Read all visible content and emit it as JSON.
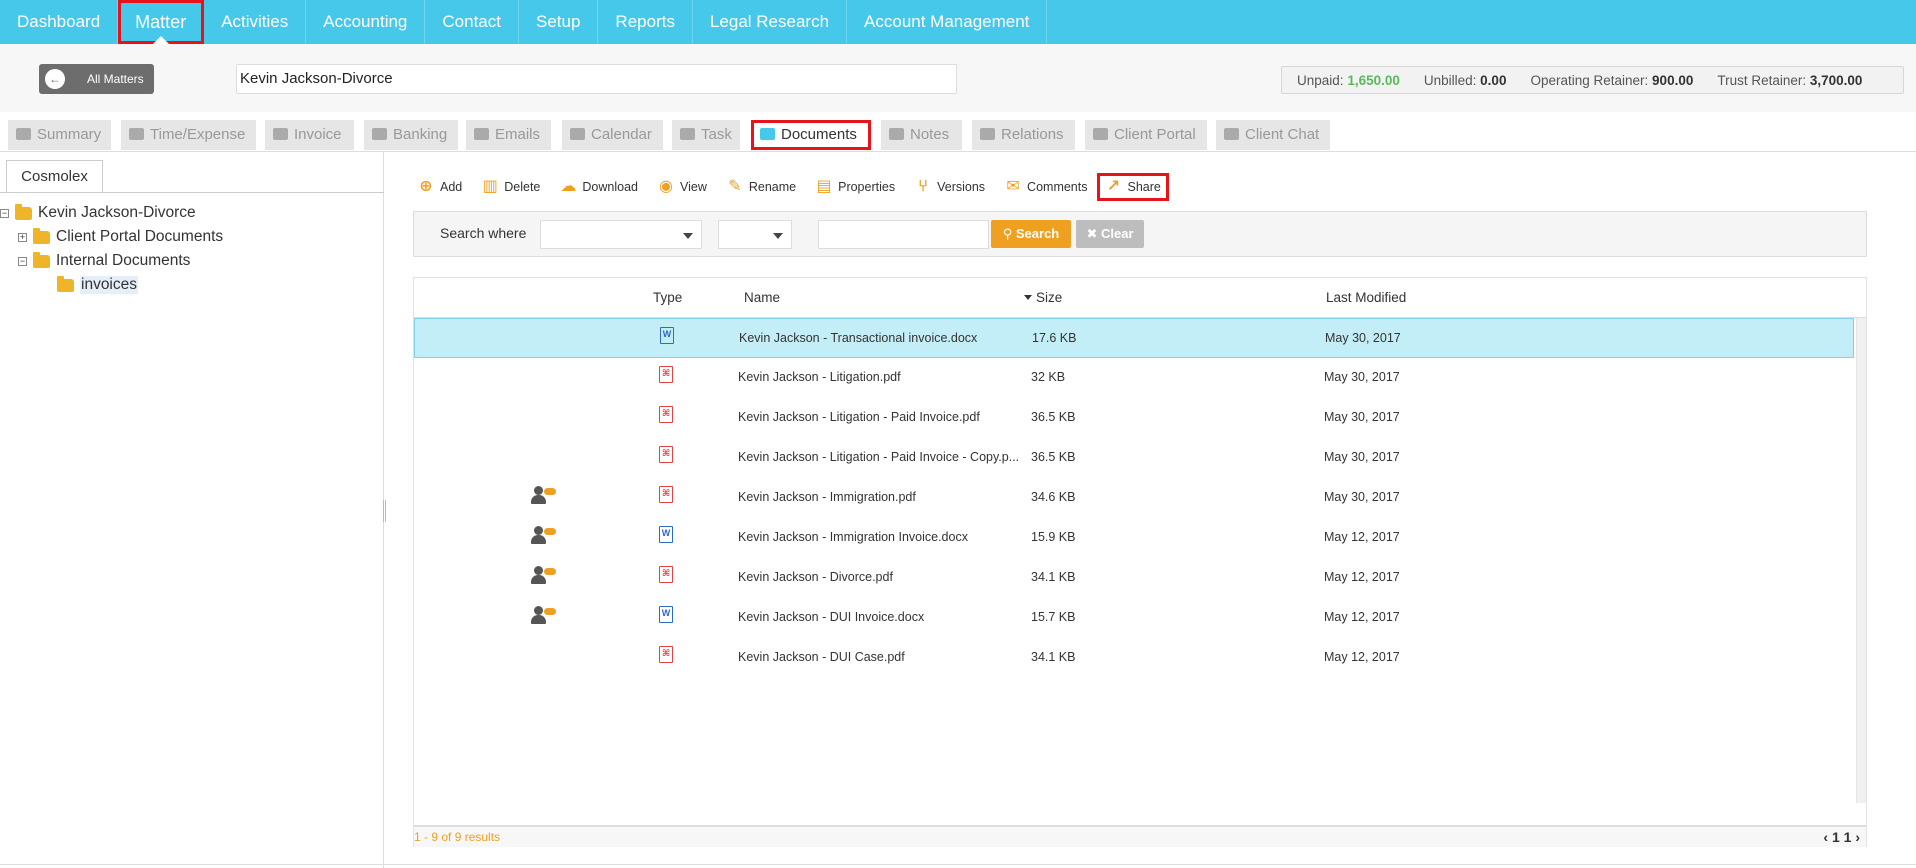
{
  "nav": {
    "items": [
      "Dashboard",
      "Matter",
      "Activities",
      "Accounting",
      "Contact",
      "Setup",
      "Reports",
      "Legal Research",
      "Account Management"
    ],
    "active": "Matter"
  },
  "header": {
    "all_matters": "All Matters",
    "matter_name": "Kevin Jackson-Divorce",
    "balances": {
      "unpaid_label": "Unpaid:",
      "unpaid": "1,650.00",
      "unbilled_label": "Unbilled:",
      "unbilled": "0.00",
      "operating_label": "Operating Retainer:",
      "operating": "900.00",
      "trust_label": "Trust Retainer:",
      "trust": "3,700.00"
    }
  },
  "tabs": [
    "Summary",
    "Time/Expense",
    "Invoice",
    "Banking",
    "Emails",
    "Calendar",
    "Task",
    "Documents",
    "Notes",
    "Relations",
    "Client Portal",
    "Client Chat"
  ],
  "active_tab": "Documents",
  "tree": {
    "tab_label": "Cosmolex",
    "root": "Kevin Jackson-Divorce",
    "client_portal": "Client Portal Documents",
    "internal": "Internal Documents",
    "invoices": "invoices"
  },
  "toolbar": {
    "add": "Add",
    "delete": "Delete",
    "download": "Download",
    "view": "View",
    "rename": "Rename",
    "properties": "Properties",
    "versions": "Versions",
    "comments": "Comments",
    "share": "Share"
  },
  "search": {
    "label": "Search where",
    "search_btn": "Search",
    "clear_btn": "Clear"
  },
  "grid": {
    "columns": {
      "type": "Type",
      "name": "Name",
      "size": "Size",
      "modified": "Last Modified"
    },
    "rows": [
      {
        "type": "word",
        "portal": false,
        "name": "Kevin Jackson - Transactional invoice.docx",
        "size": "17.6 KB",
        "modified": "May 30, 2017"
      },
      {
        "type": "pdf",
        "portal": false,
        "name": "Kevin Jackson - Litigation.pdf",
        "size": "32 KB",
        "modified": "May 30, 2017"
      },
      {
        "type": "pdf",
        "portal": false,
        "name": "Kevin Jackson - Litigation - Paid Invoice.pdf",
        "size": "36.5 KB",
        "modified": "May 30, 2017"
      },
      {
        "type": "pdf",
        "portal": false,
        "name": "Kevin Jackson - Litigation - Paid Invoice - Copy.p...",
        "size": "36.5 KB",
        "modified": "May 30, 2017"
      },
      {
        "type": "pdf",
        "portal": true,
        "name": "Kevin Jackson - Immigration.pdf",
        "size": "34.6 KB",
        "modified": "May 30, 2017"
      },
      {
        "type": "word",
        "portal": true,
        "name": "Kevin Jackson - Immigration Invoice.docx",
        "size": "15.9 KB",
        "modified": "May 12, 2017"
      },
      {
        "type": "pdf",
        "portal": true,
        "name": "Kevin Jackson - Divorce.pdf",
        "size": "34.1 KB",
        "modified": "May 12, 2017"
      },
      {
        "type": "word",
        "portal": true,
        "name": "Kevin Jackson - DUI Invoice.docx",
        "size": "15.7 KB",
        "modified": "May 12, 2017"
      },
      {
        "type": "pdf",
        "portal": false,
        "name": "Kevin Jackson - DUI Case.pdf",
        "size": "34.1 KB",
        "modified": "May 12, 2017"
      }
    ],
    "results": "1 - 9 of 9 results",
    "pager": {
      "prev": "‹",
      "page": "1",
      "total": "1",
      "next": "›"
    }
  }
}
